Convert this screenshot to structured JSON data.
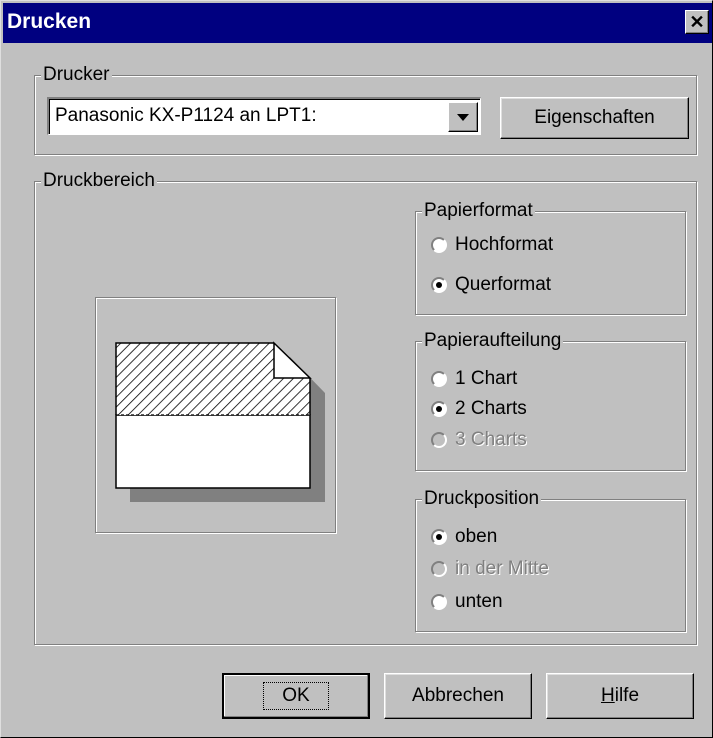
{
  "window": {
    "title": "Drucken",
    "close_glyph": "✕"
  },
  "printer_group": {
    "legend": "Drucker",
    "selected_printer": "Panasonic KX-P1124 an LPT1:",
    "properties_button": "Eigenschaften"
  },
  "print_area_group": {
    "legend": "Druckbereich"
  },
  "paper_format": {
    "legend": "Papierformat",
    "options": [
      {
        "label": "Hochformat",
        "checked": false,
        "disabled": false
      },
      {
        "label": "Querformat",
        "checked": true,
        "disabled": false
      }
    ]
  },
  "paper_division": {
    "legend": "Papieraufteilung",
    "options": [
      {
        "label": "1 Chart",
        "checked": false,
        "disabled": false
      },
      {
        "label": "2 Charts",
        "checked": true,
        "disabled": false
      },
      {
        "label": "3 Charts",
        "checked": false,
        "disabled": true
      }
    ]
  },
  "print_position": {
    "legend": "Druckposition",
    "options": [
      {
        "label": "oben",
        "checked": true,
        "disabled": false
      },
      {
        "label": "in der Mitte",
        "checked": false,
        "disabled": true
      },
      {
        "label": "unten",
        "checked": false,
        "disabled": false
      }
    ]
  },
  "buttons": {
    "ok": "OK",
    "cancel": "Abbrechen",
    "help_mnemonic": "H",
    "help_rest": "ilfe"
  },
  "colors": {
    "titlebar": "#000080",
    "face": "#c0c0c0"
  },
  "icons": {
    "close": "close-icon",
    "dropdown": "chevron-down-icon",
    "preview": "page-preview-icon"
  }
}
